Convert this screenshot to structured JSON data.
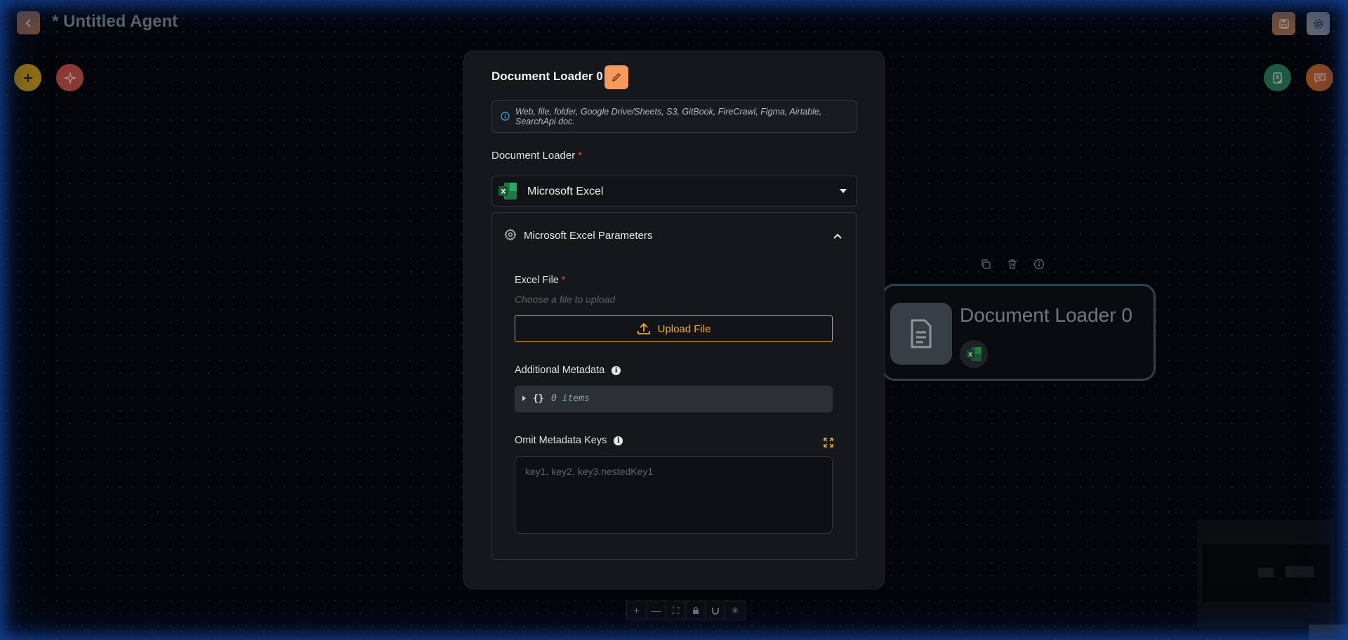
{
  "header": {
    "title": "* Untitled Agent"
  },
  "canvas": {
    "node": {
      "title": "Document Loader 0"
    },
    "controls": [
      "+",
      "—",
      "⛶",
      "🔒",
      "⋓",
      "✳"
    ]
  },
  "modal": {
    "title": "Document Loader 0",
    "info": "Web, file, folder, Google Drive/Sheets, S3, GitBook, FireCrawl, Figma, Airtable, SearchApi doc.",
    "loader_label": "Document Loader",
    "required_mark": "*",
    "selected_loader": "Microsoft Excel",
    "params_title": "Microsoft Excel Parameters",
    "excel_file_label": "Excel File",
    "excel_file_placeholder": "Choose a file to upload",
    "upload_button": "Upload File",
    "metadata_label": "Additional Metadata",
    "metadata_braces": "{}",
    "metadata_count": "0 items",
    "omit_label": "Omit Metadata Keys",
    "omit_placeholder": "key1, key2, key3.nestedKey1"
  },
  "colors": {
    "accent_orange": "#f59a5c",
    "upload_yellow": "#f0b030",
    "required_red": "#e64545",
    "add_button": "#c99a1a",
    "sparkle_button": "#c0504a",
    "validate_button": "#2f7a5e",
    "chat_button": "#c6652e"
  },
  "icons": {
    "back": "chevron-left-icon",
    "save": "save-icon",
    "settings": "gear-icon",
    "add": "plus-icon",
    "sparkle": "sparkle-icon",
    "validate": "checklist-icon",
    "chat": "chat-icon",
    "edit": "pencil-icon",
    "info": "info-icon",
    "excel": "excel-icon",
    "upload": "upload-icon",
    "expand": "expand-icon"
  }
}
